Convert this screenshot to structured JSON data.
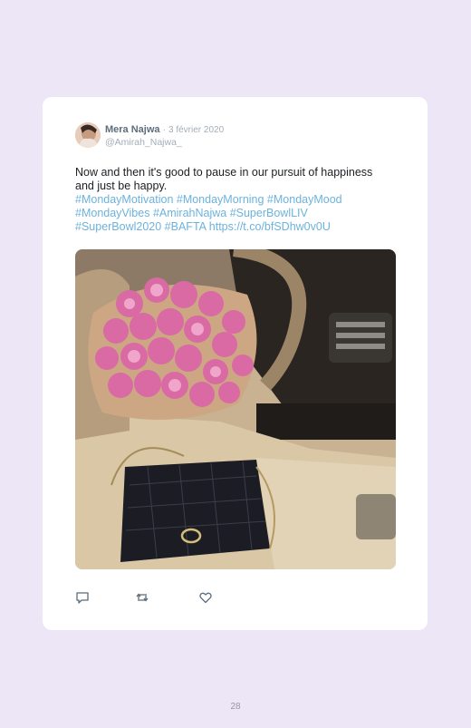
{
  "tweet": {
    "author_name": "Mera Najwa",
    "date_sep": "·",
    "date": "3 février 2020",
    "handle": "@Amirah_Najwa_",
    "text_line1": "Now and then it's good to pause in our pursuit of happiness",
    "text_line2": "and just be happy.",
    "tags_line1": "#MondayMotivation #MondayMorning #MondayMood",
    "tags_line2": "#MondayVibes #AmirahNajwa #SuperBowlLIV",
    "tags_line3": "#SuperBowl2020 #BAFTA https://t.co/bfSDhw0v0U"
  },
  "actions": [
    {
      "icon": "reply-icon"
    },
    {
      "icon": "retweet-icon"
    },
    {
      "icon": "heart-icon"
    }
  ],
  "page_number": "28",
  "colors": {
    "background": "#ece6f7",
    "card": "#ffffff",
    "link": "#6cb2dd",
    "muted": "#a3adb8"
  }
}
